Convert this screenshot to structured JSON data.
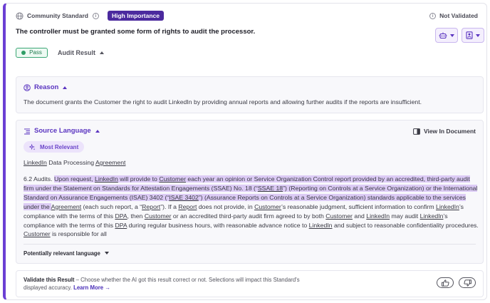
{
  "header": {
    "standard_type": "Community Standard",
    "importance": "High Importance",
    "validation_status": "Not Validated"
  },
  "title": "The controller must be granted some form of rights to audit the processor.",
  "result": {
    "status": "Pass",
    "section_label": "Audit Result"
  },
  "reason": {
    "heading": "Reason",
    "text": "The document grants the Customer the right to audit LinkedIn by providing annual reports and allowing further audits if the reports are insufficient."
  },
  "source": {
    "heading": "Source Language",
    "view_in_document": "View In Document",
    "badge": "Most Relevant",
    "doc_name_1": "LinkedIn",
    "doc_name_2": "Data Processing",
    "doc_name_3": "Agreement",
    "potentially_relevant": "Potentially relevant language",
    "p": [
      "6.2 Audits. ",
      "Upon request, ",
      "LinkedIn",
      " will provide to ",
      "Customer",
      " each year an opinion or Service Organization Control report provided by an accredited, third-party audit firm under the Statement on Standards for Attestation Engagements (SSAE) No. 18 (“",
      "SSAE 18",
      "”) (Reporting on Controls at a Service Organization) or the International Standard on Assurance Engagements (ISAE) 3402 (“",
      "ISAE 3402",
      "”) (Assurance Reports on Controls at a Service Organization) standards applicable to the services under the ",
      "Agreement",
      " (each such report, a “",
      "Report",
      "”). If a ",
      "Report",
      " does not provide, in ",
      "Customer",
      "’s reasonable judgment, sufficient information to confirm ",
      "LinkedIn",
      "’s compliance with the terms of this ",
      "DPA",
      ", then ",
      "Customer",
      " or an accredited third-party audit firm agreed to by both ",
      "Customer",
      " and ",
      "LinkedIn",
      " may audit ",
      "LinkedIn",
      "’s compliance with the terms of this ",
      "DPA",
      " during regular business hours, with reasonable advance notice to ",
      "LinkedIn",
      " and subject to reasonable confidentiality procedures. ",
      "Customer",
      " is responsible for all"
    ]
  },
  "footer": {
    "title": "Validate this Result",
    "dash": " – ",
    "description": "Choose whether the AI got this result correct or not. Selections will impact this Standard's displayed accuracy.",
    "learn_more": "Learn More →"
  },
  "colors": {
    "accent": "#6b3fd4",
    "importance_badge": "#4b2a9e",
    "highlight": "#dccbf5",
    "pass": "#2f9e66"
  },
  "icons": [
    "globe-icon",
    "info-icon",
    "robot-icon",
    "contact-icon",
    "reason-icon",
    "source-list-icon",
    "view-document-icon",
    "sparkle-icon",
    "thumbs-up-icon",
    "thumbs-down-icon"
  ]
}
